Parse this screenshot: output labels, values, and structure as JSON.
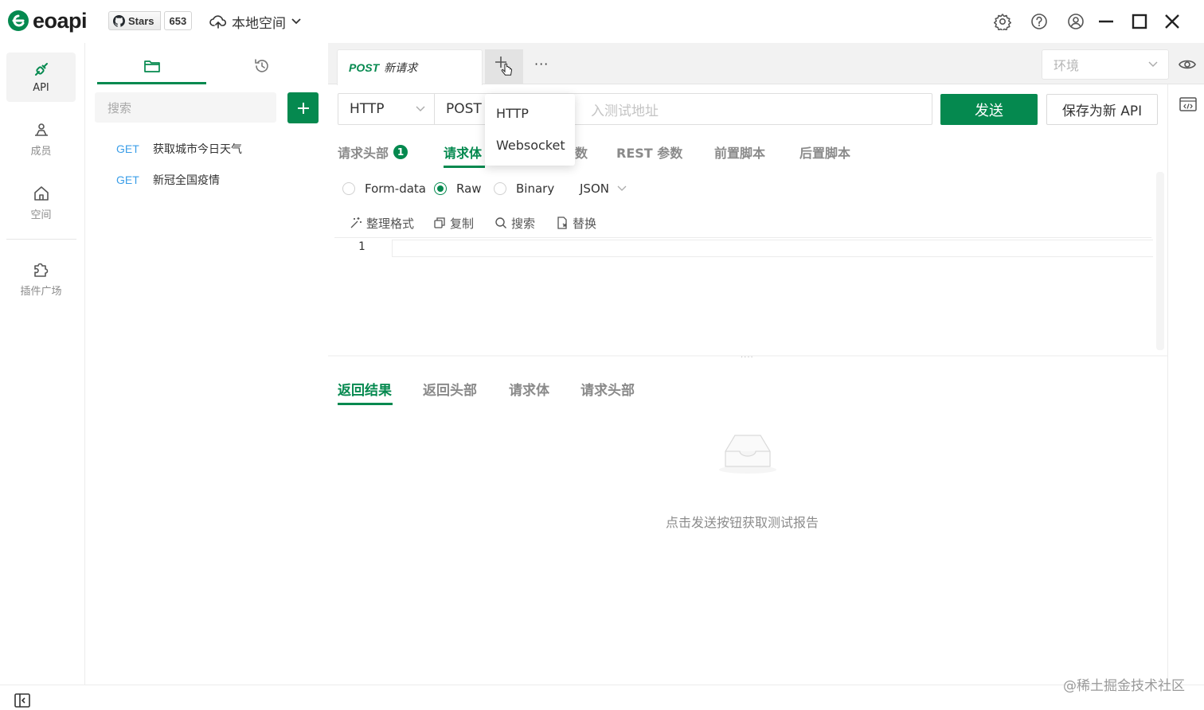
{
  "app": {
    "logo_text": "eoapi",
    "github": {
      "stars_label": "Stars",
      "stars_count": "653"
    },
    "workspace": "本地空间"
  },
  "rail": {
    "items": [
      {
        "label": "API",
        "icon": "api-icon"
      },
      {
        "label": "成员",
        "icon": "members-icon"
      },
      {
        "label": "空间",
        "icon": "home-icon"
      },
      {
        "label": "插件广场",
        "icon": "puzzle-icon"
      }
    ]
  },
  "panel": {
    "search_placeholder": "搜索",
    "apis": [
      {
        "method": "GET",
        "name": "获取城市今日天气"
      },
      {
        "method": "GET",
        "name": "新冠全国疫情"
      }
    ]
  },
  "tabs": {
    "request_tab": {
      "method": "POST",
      "title": "新请求"
    },
    "more": "···",
    "env_placeholder": "环境"
  },
  "request": {
    "protocol": "HTTP",
    "method": "POST",
    "url_placeholder": "入测试地址",
    "send_label": "发送",
    "save_label": "保存为新 API"
  },
  "request_tabs": [
    {
      "label": "请求头部",
      "badge": "1"
    },
    {
      "label": "请求体"
    },
    {
      "label": "数"
    },
    {
      "label": "REST 参数"
    },
    {
      "label": "前置脚本"
    },
    {
      "label": "后置脚本"
    }
  ],
  "body": {
    "formats": [
      {
        "label": "Form-data",
        "selected": false
      },
      {
        "label": "Raw",
        "selected": true
      },
      {
        "label": "Binary",
        "selected": false
      }
    ],
    "content_type": "JSON",
    "tools": [
      "整理格式",
      "复制",
      "搜索",
      "替换"
    ],
    "line_number": "1"
  },
  "dropdown": {
    "items": [
      "HTTP",
      "Websocket"
    ]
  },
  "response": {
    "tabs": [
      "返回结果",
      "返回头部",
      "请求体",
      "请求头部"
    ],
    "empty_text": "点击发送按钮获取测试报告"
  },
  "watermark": "@稀土掘金技术社区",
  "colors": {
    "primary": "#05894f",
    "get_method": "#3b9ee8"
  }
}
